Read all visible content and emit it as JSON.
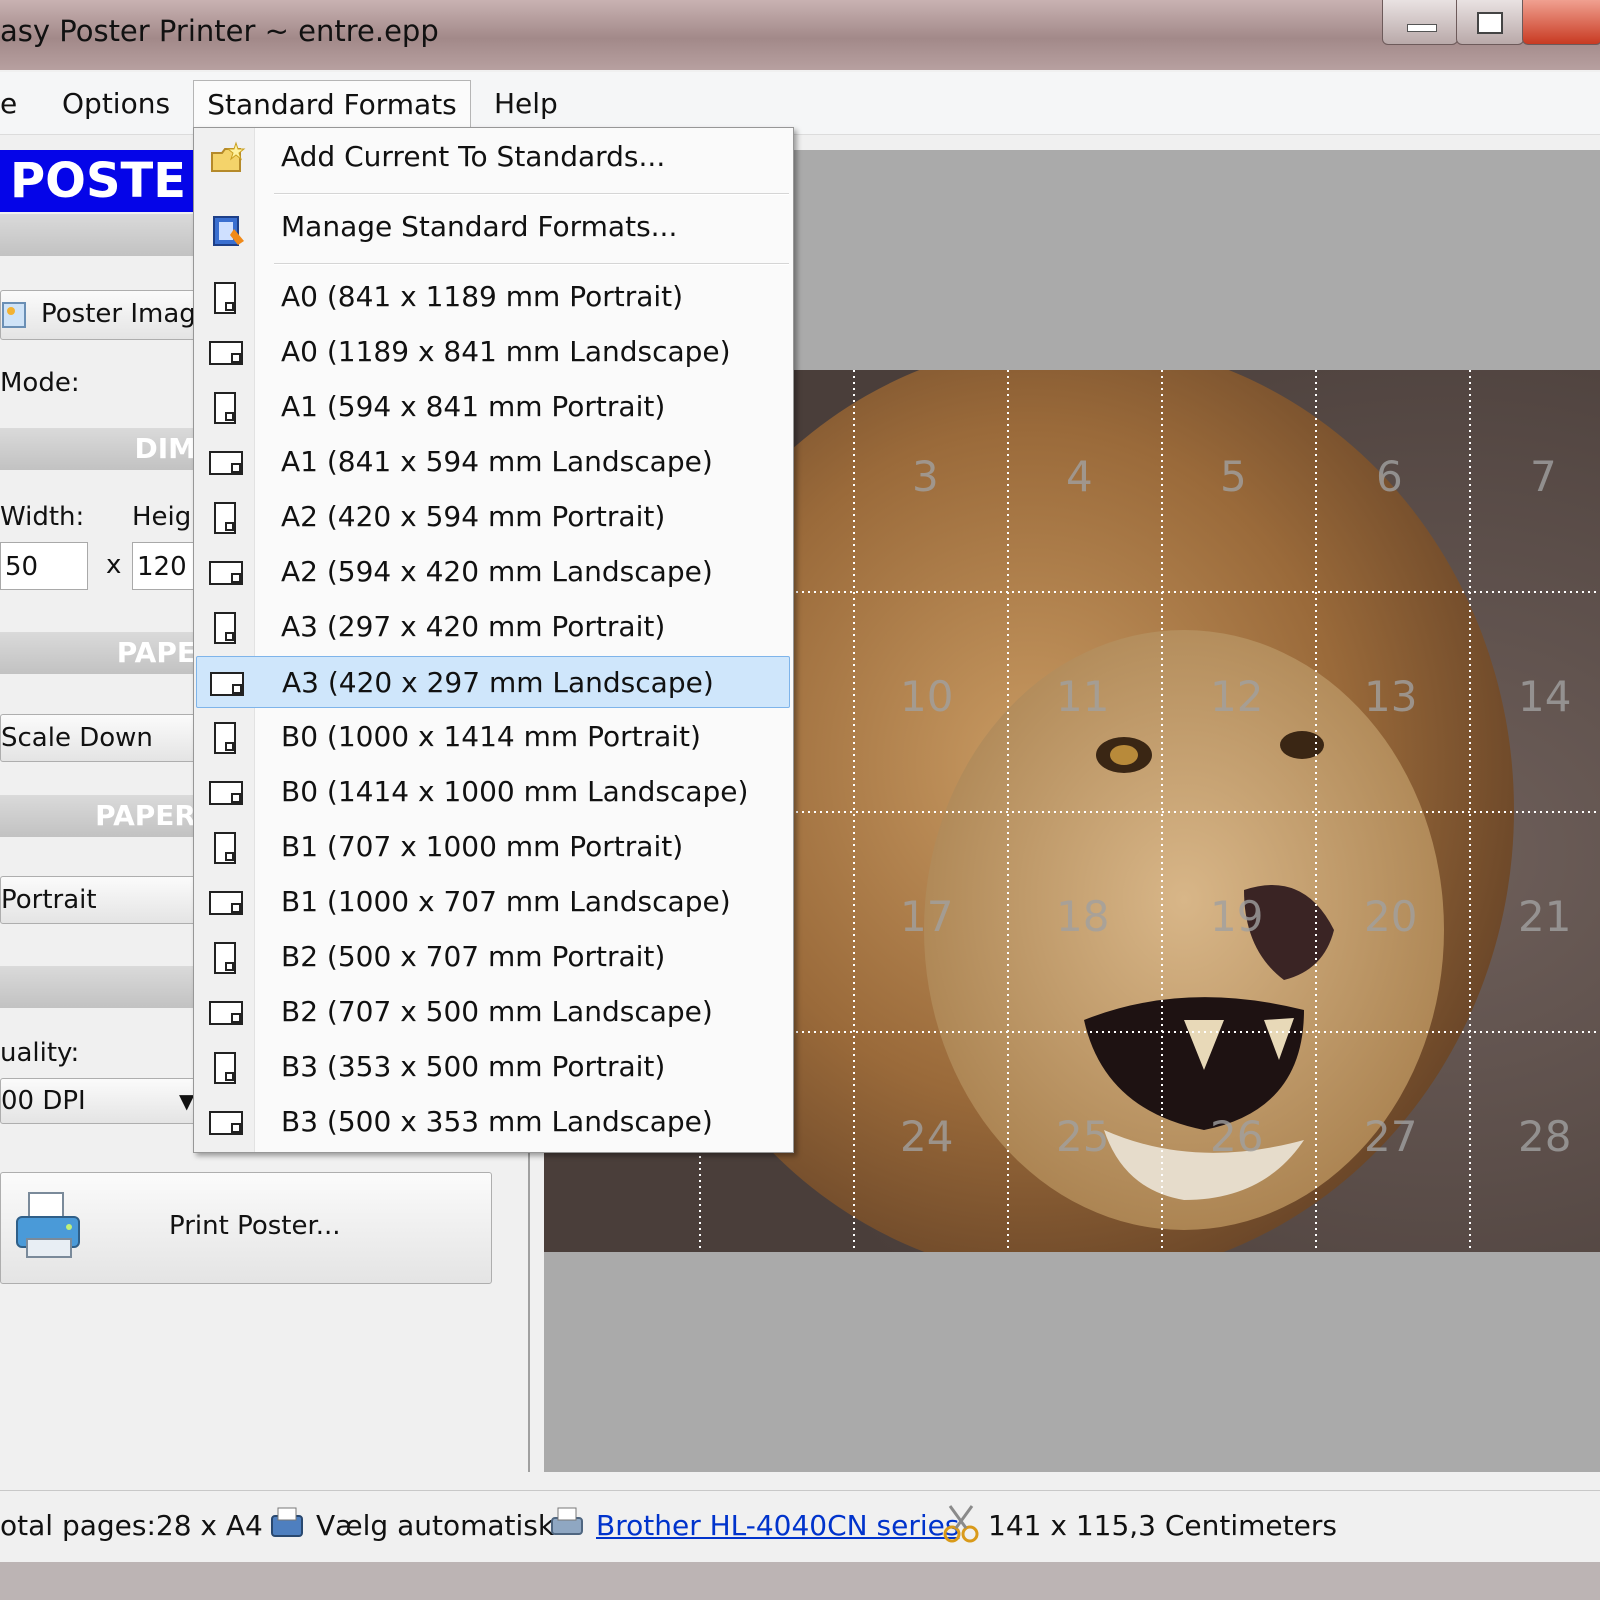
{
  "window": {
    "title": "asy Poster Printer ~ entre.epp",
    "controls": [
      "minimize",
      "maximize",
      "close"
    ]
  },
  "menubar": {
    "items": [
      {
        "label": "e"
      },
      {
        "label": "Options"
      },
      {
        "label": "Standard Formats"
      },
      {
        "label": "Help"
      }
    ]
  },
  "left_panel": {
    "banner": "POSTE",
    "poster_image_button": "Poster Image",
    "mode_label": "Mode:",
    "dimensions_header": "DIM",
    "width_label": "Width:",
    "height_label": "Heigh",
    "width_value": "50",
    "times": "x",
    "height_value": "120",
    "paper_header": "PAPE",
    "scale_button": "Scale Down",
    "paper_orientation_header": "PAPER",
    "orientation_value": "Portrait",
    "quality_label": "uality:",
    "quality_value": "00 DPI",
    "print_button": "Print Poster..."
  },
  "dropdown": {
    "items": [
      {
        "label": "Add Current To Standards...",
        "icon": "folder-star-icon"
      },
      {
        "label": "Manage Standard Formats...",
        "icon": "manage-formats-icon"
      },
      {
        "label": "A0 (841 x 1189 mm Portrait)",
        "icon": "page-portrait-icon"
      },
      {
        "label": "A0 (1189 x 841 mm Landscape)",
        "icon": "page-landscape-icon"
      },
      {
        "label": "A1 (594 x 841 mm Portrait)",
        "icon": "page-portrait-icon"
      },
      {
        "label": "A1 (841 x 594 mm Landscape)",
        "icon": "page-landscape-icon"
      },
      {
        "label": "A2 (420 x 594 mm Portrait)",
        "icon": "page-portrait-icon"
      },
      {
        "label": "A2 (594 x 420 mm Landscape)",
        "icon": "page-landscape-icon"
      },
      {
        "label": "A3 (297 x 420 mm Portrait)",
        "icon": "page-portrait-icon"
      },
      {
        "label": "A3 (420 x 297 mm Landscape)",
        "icon": "page-landscape-icon",
        "selected": true
      },
      {
        "label": "B0 (1000 x 1414 mm Portrait)",
        "icon": "page-portrait-icon"
      },
      {
        "label": "B0 (1414 x 1000 mm Landscape)",
        "icon": "page-landscape-icon"
      },
      {
        "label": "B1 (707 x 1000 mm Portrait)",
        "icon": "page-portrait-icon"
      },
      {
        "label": "B1 (1000 x 707 mm Landscape)",
        "icon": "page-landscape-icon"
      },
      {
        "label": "B2 (500 x 707 mm Portrait)",
        "icon": "page-portrait-icon"
      },
      {
        "label": "B2 (707 x 500 mm Landscape)",
        "icon": "page-landscape-icon"
      },
      {
        "label": "B3 (353 x 500 mm Portrait)",
        "icon": "page-portrait-icon"
      },
      {
        "label": "B3 (500 x 353 mm Landscape)",
        "icon": "page-landscape-icon"
      }
    ]
  },
  "preview": {
    "tile_numbers": [
      "3",
      "4",
      "5",
      "6",
      "7",
      "10",
      "11",
      "12",
      "13",
      "14",
      "17",
      "18",
      "19",
      "20",
      "21",
      "24",
      "25",
      "26",
      "27",
      "28"
    ]
  },
  "statusbar": {
    "total_pages": "otal pages:28 x A4",
    "paper_source": "Vælg automatisk",
    "printer_link": "Brother HL-4040CN series",
    "size": "141 x 115,3 Centimeters"
  },
  "colors": {
    "banner_blue": "#0505e8",
    "selection": "#cfe6fb",
    "link": "#0033cc",
    "canvas": "#aaaaaa"
  }
}
